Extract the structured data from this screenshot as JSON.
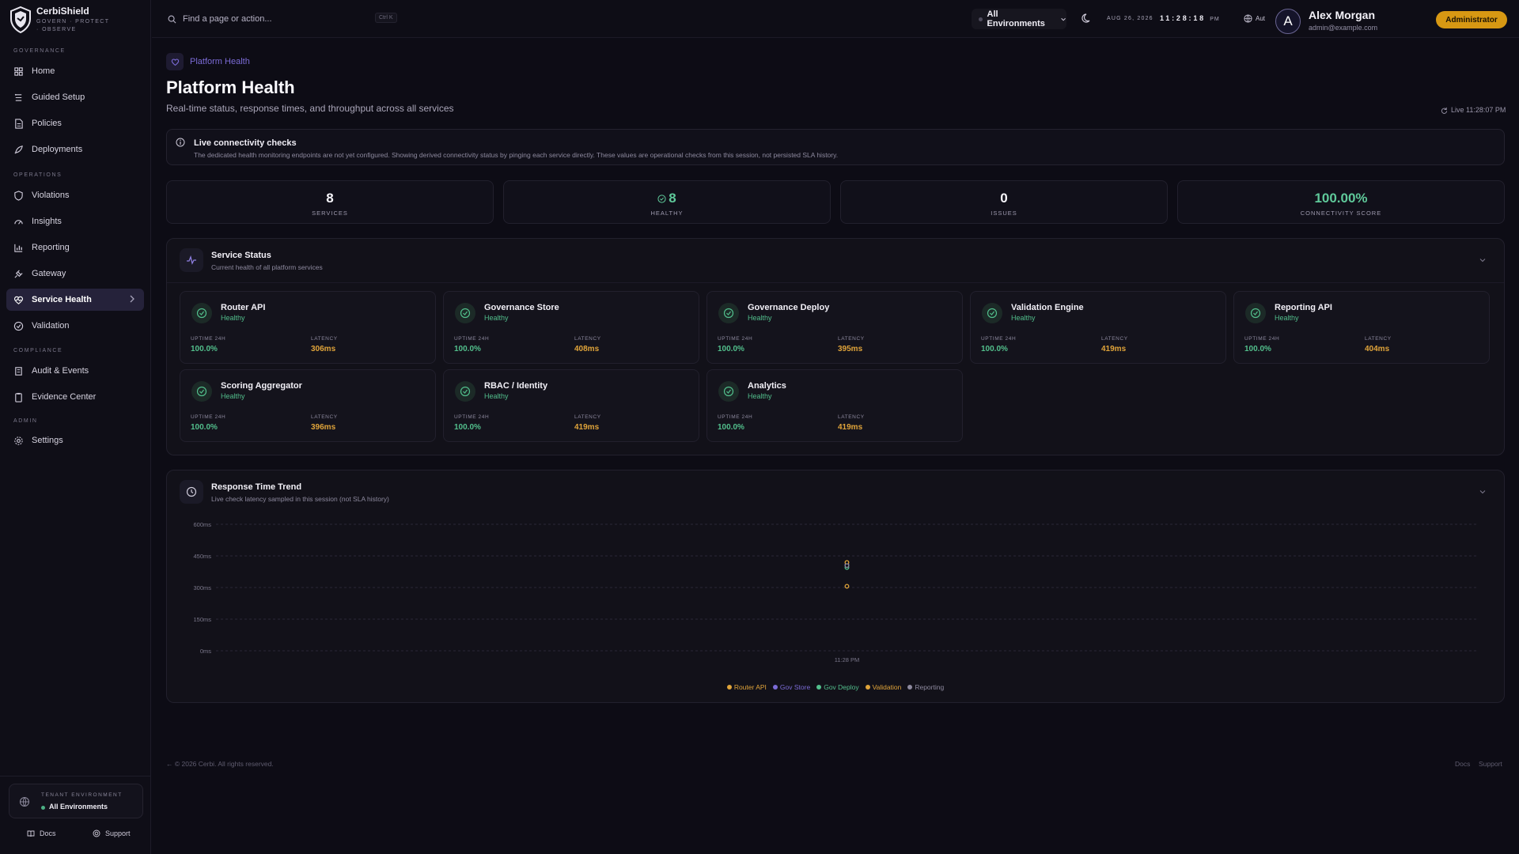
{
  "app": {
    "name": "CerbiShield",
    "tagline": "GOVERN · PROTECT · OBSERVE"
  },
  "sidebar": {
    "sections": [
      {
        "label": "GOVERNANCE"
      },
      {
        "label": "OPERATIONS"
      },
      {
        "label": "COMPLIANCE"
      },
      {
        "label": "ADMIN"
      }
    ],
    "items": [
      {
        "label": "Home",
        "icon": "home-icon"
      },
      {
        "label": "Guided Setup",
        "icon": "guided-setup-icon"
      },
      {
        "label": "Policies",
        "icon": "policies-icon"
      },
      {
        "label": "Deployments",
        "icon": "rocket-icon"
      },
      {
        "label": "Violations",
        "icon": "shield-icon"
      },
      {
        "label": "Insights",
        "icon": "insights-icon"
      },
      {
        "label": "Reporting",
        "icon": "bar-chart-icon"
      },
      {
        "label": "Gateway",
        "icon": "plug-icon"
      },
      {
        "label": "Service Health",
        "icon": "heart-pulse-icon",
        "active": true
      },
      {
        "label": "Validation",
        "icon": "check-circle-icon"
      },
      {
        "label": "Audit & Events",
        "icon": "audit-icon"
      },
      {
        "label": "Evidence Center",
        "icon": "clipboard-icon"
      },
      {
        "label": "Settings",
        "icon": "gear-icon"
      }
    ],
    "tenant": {
      "label": "TENANT ENVIRONMENT",
      "value": "All Environments"
    },
    "footer": {
      "docs": "Docs",
      "support": "Support"
    }
  },
  "topbar": {
    "search_placeholder": "Find a page or action...",
    "shortcut": "Ctrl K",
    "environment": "All Environments",
    "date": "AUG 26, 2026",
    "time": "11:28:18",
    "ampm": "PM",
    "language": "Aut",
    "user": {
      "initial": "A",
      "name": "Alex Morgan",
      "email": "admin@example.com"
    },
    "role": "Administrator"
  },
  "page": {
    "breadcrumb": "Platform Health",
    "title": "Platform Health",
    "subtitle": "Real-time status, response times, and throughput across all services",
    "live": "Live 11:28:07 PM"
  },
  "notice": {
    "title": "Live connectivity checks",
    "body": "The dedicated health monitoring endpoints are not yet configured. Showing derived connectivity status by pinging each service directly. These values are operational checks from this session, not persisted SLA history."
  },
  "stats": [
    {
      "value": "8",
      "label": "SERVICES"
    },
    {
      "value": "8",
      "label": "HEALTHY"
    },
    {
      "value": "0",
      "label": "ISSUES"
    },
    {
      "value": "100.00%",
      "label": "CONNECTIVITY SCORE"
    }
  ],
  "service_status": {
    "title": "Service Status",
    "subtitle": "Current health of all platform services",
    "uptime_label": "UPTIME 24H",
    "latency_label": "LATENCY",
    "services": [
      {
        "name": "Router API",
        "status": "Healthy",
        "uptime": "100.0%",
        "latency": "306ms"
      },
      {
        "name": "Governance Store",
        "status": "Healthy",
        "uptime": "100.0%",
        "latency": "408ms"
      },
      {
        "name": "Governance Deploy",
        "status": "Healthy",
        "uptime": "100.0%",
        "latency": "395ms"
      },
      {
        "name": "Validation Engine",
        "status": "Healthy",
        "uptime": "100.0%",
        "latency": "419ms"
      },
      {
        "name": "Reporting API",
        "status": "Healthy",
        "uptime": "100.0%",
        "latency": "404ms"
      },
      {
        "name": "Scoring Aggregator",
        "status": "Healthy",
        "uptime": "100.0%",
        "latency": "396ms"
      },
      {
        "name": "RBAC / Identity",
        "status": "Healthy",
        "uptime": "100.0%",
        "latency": "419ms"
      },
      {
        "name": "Analytics",
        "status": "Healthy",
        "uptime": "100.0%",
        "latency": "419ms"
      }
    ]
  },
  "response_trend": {
    "title": "Response Time Trend",
    "subtitle": "Live check latency sampled in this session (not SLA history)"
  },
  "chart_data": {
    "type": "scatter",
    "x": [
      "11:28 PM"
    ],
    "ylim": [
      0,
      600
    ],
    "y_ticks": [
      "600ms",
      "450ms",
      "300ms",
      "150ms",
      "0ms"
    ],
    "grid": true,
    "legend_position": "bottom",
    "series": [
      {
        "name": "Router API",
        "color": "#e0a43a",
        "values": [
          306
        ]
      },
      {
        "name": "Gov Store",
        "color": "#7b6bd6",
        "values": [
          408
        ]
      },
      {
        "name": "Gov Deploy",
        "color": "#52bf8c",
        "values": [
          395
        ]
      },
      {
        "name": "Validation",
        "color": "#e0a43a",
        "values": [
          419
        ]
      },
      {
        "name": "Reporting",
        "color": "#8d899e",
        "values": [
          404
        ]
      }
    ]
  },
  "footer": {
    "copyright": "← © 2026 Cerbi. All rights reserved.",
    "docs": "Docs",
    "support": "Support"
  },
  "colors": {
    "accent": "#7b6bd6",
    "healthy": "#52bf8c",
    "latency": "#e0a43a",
    "role_badge": "#d79813"
  }
}
